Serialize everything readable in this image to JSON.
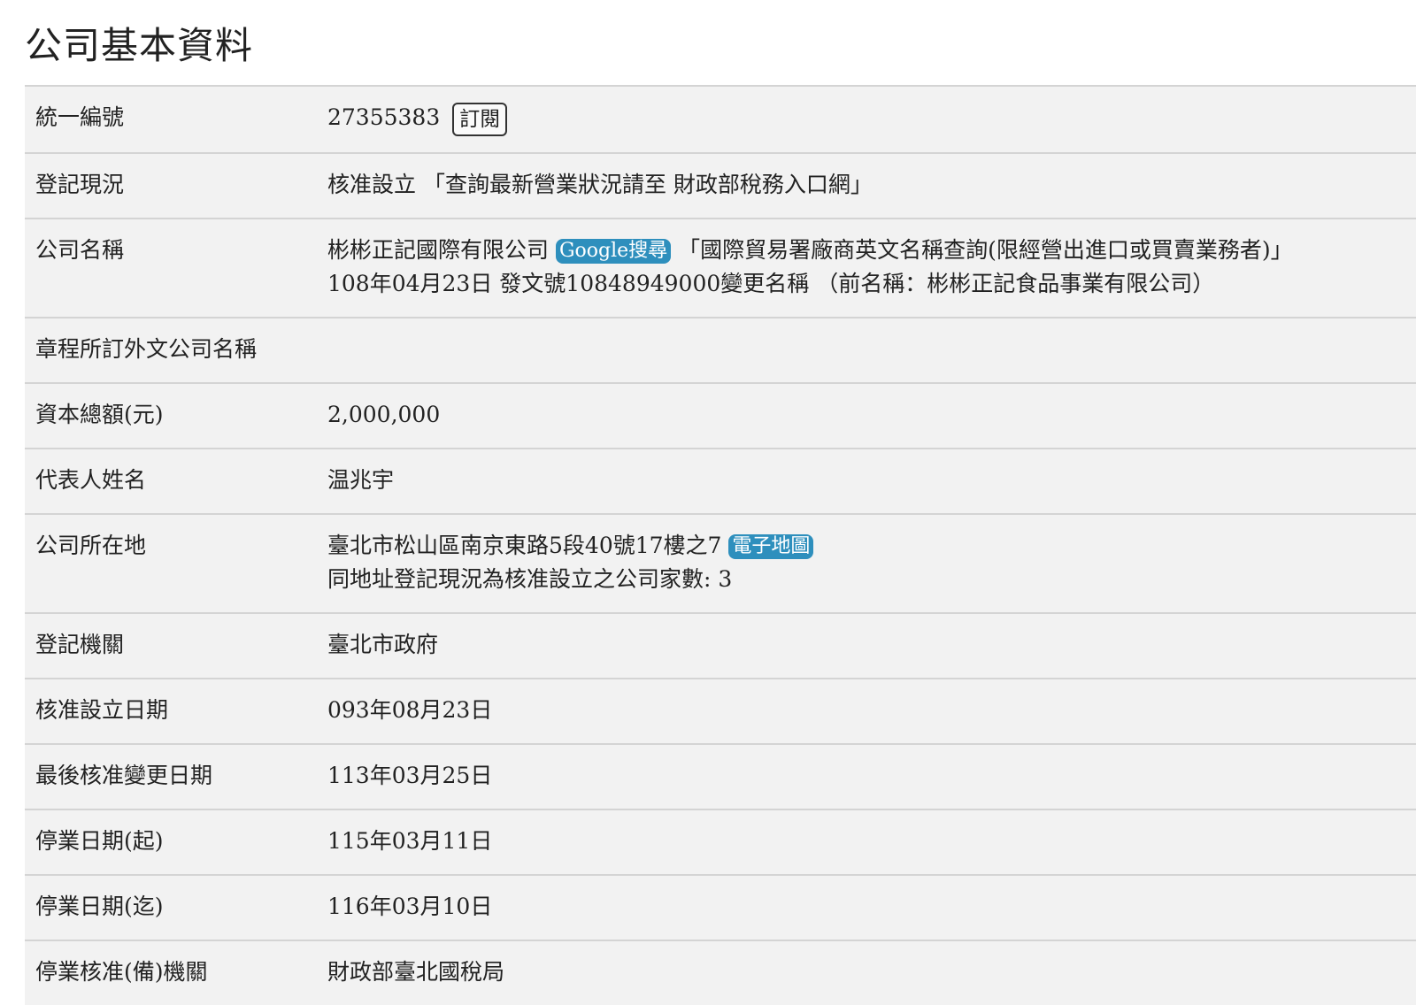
{
  "page_title": "公司基本資料",
  "rows": {
    "tax_id": {
      "label": "統一編號",
      "value": "27355383",
      "subscribe_label": "訂閱"
    },
    "status": {
      "label": "登記現況",
      "value": "核准設立",
      "link_text": "「查詢最新營業狀況請至 財政部稅務入口網」"
    },
    "company_name": {
      "label": "公司名稱",
      "value": "彬彬正記國際有限公司",
      "google_label": "Google搜尋",
      "trade_link_text": "「國際貿易署廠商英文名稱查詢(限經營出進口或買賣業務者)」",
      "name_change_note": "108年04月23日 發文號10848949000變更名稱 （前名稱：彬彬正記食品事業有限公司）"
    },
    "foreign_name": {
      "label": "章程所訂外文公司名稱",
      "value": ""
    },
    "capital": {
      "label": "資本總額(元)",
      "value": "2,000,000"
    },
    "representative": {
      "label": "代表人姓名",
      "value": "温兆宇"
    },
    "address": {
      "label": "公司所在地",
      "value": "臺北市松山區南京東路5段40號17樓之7",
      "map_label": "電子地圖",
      "same_address_note": "同地址登記現況為核准設立之公司家數: 3"
    },
    "registration_authority": {
      "label": "登記機關",
      "value": "臺北市政府"
    },
    "approval_date": {
      "label": "核准設立日期",
      "value": "093年08月23日"
    },
    "last_change_date": {
      "label": "最後核准變更日期",
      "value": "113年03月25日"
    },
    "suspension_start": {
      "label": "停業日期(起)",
      "value": "115年03月11日"
    },
    "suspension_end": {
      "label": "停業日期(迄)",
      "value": "116年03月10日"
    },
    "suspension_authority": {
      "label": "停業核准(備)機關",
      "value": "財政部臺北國稅局"
    }
  },
  "colors": {
    "row_background": "#f2f2f2",
    "row_border": "#d4d4d4",
    "link_chip": "#2e8fbd"
  }
}
